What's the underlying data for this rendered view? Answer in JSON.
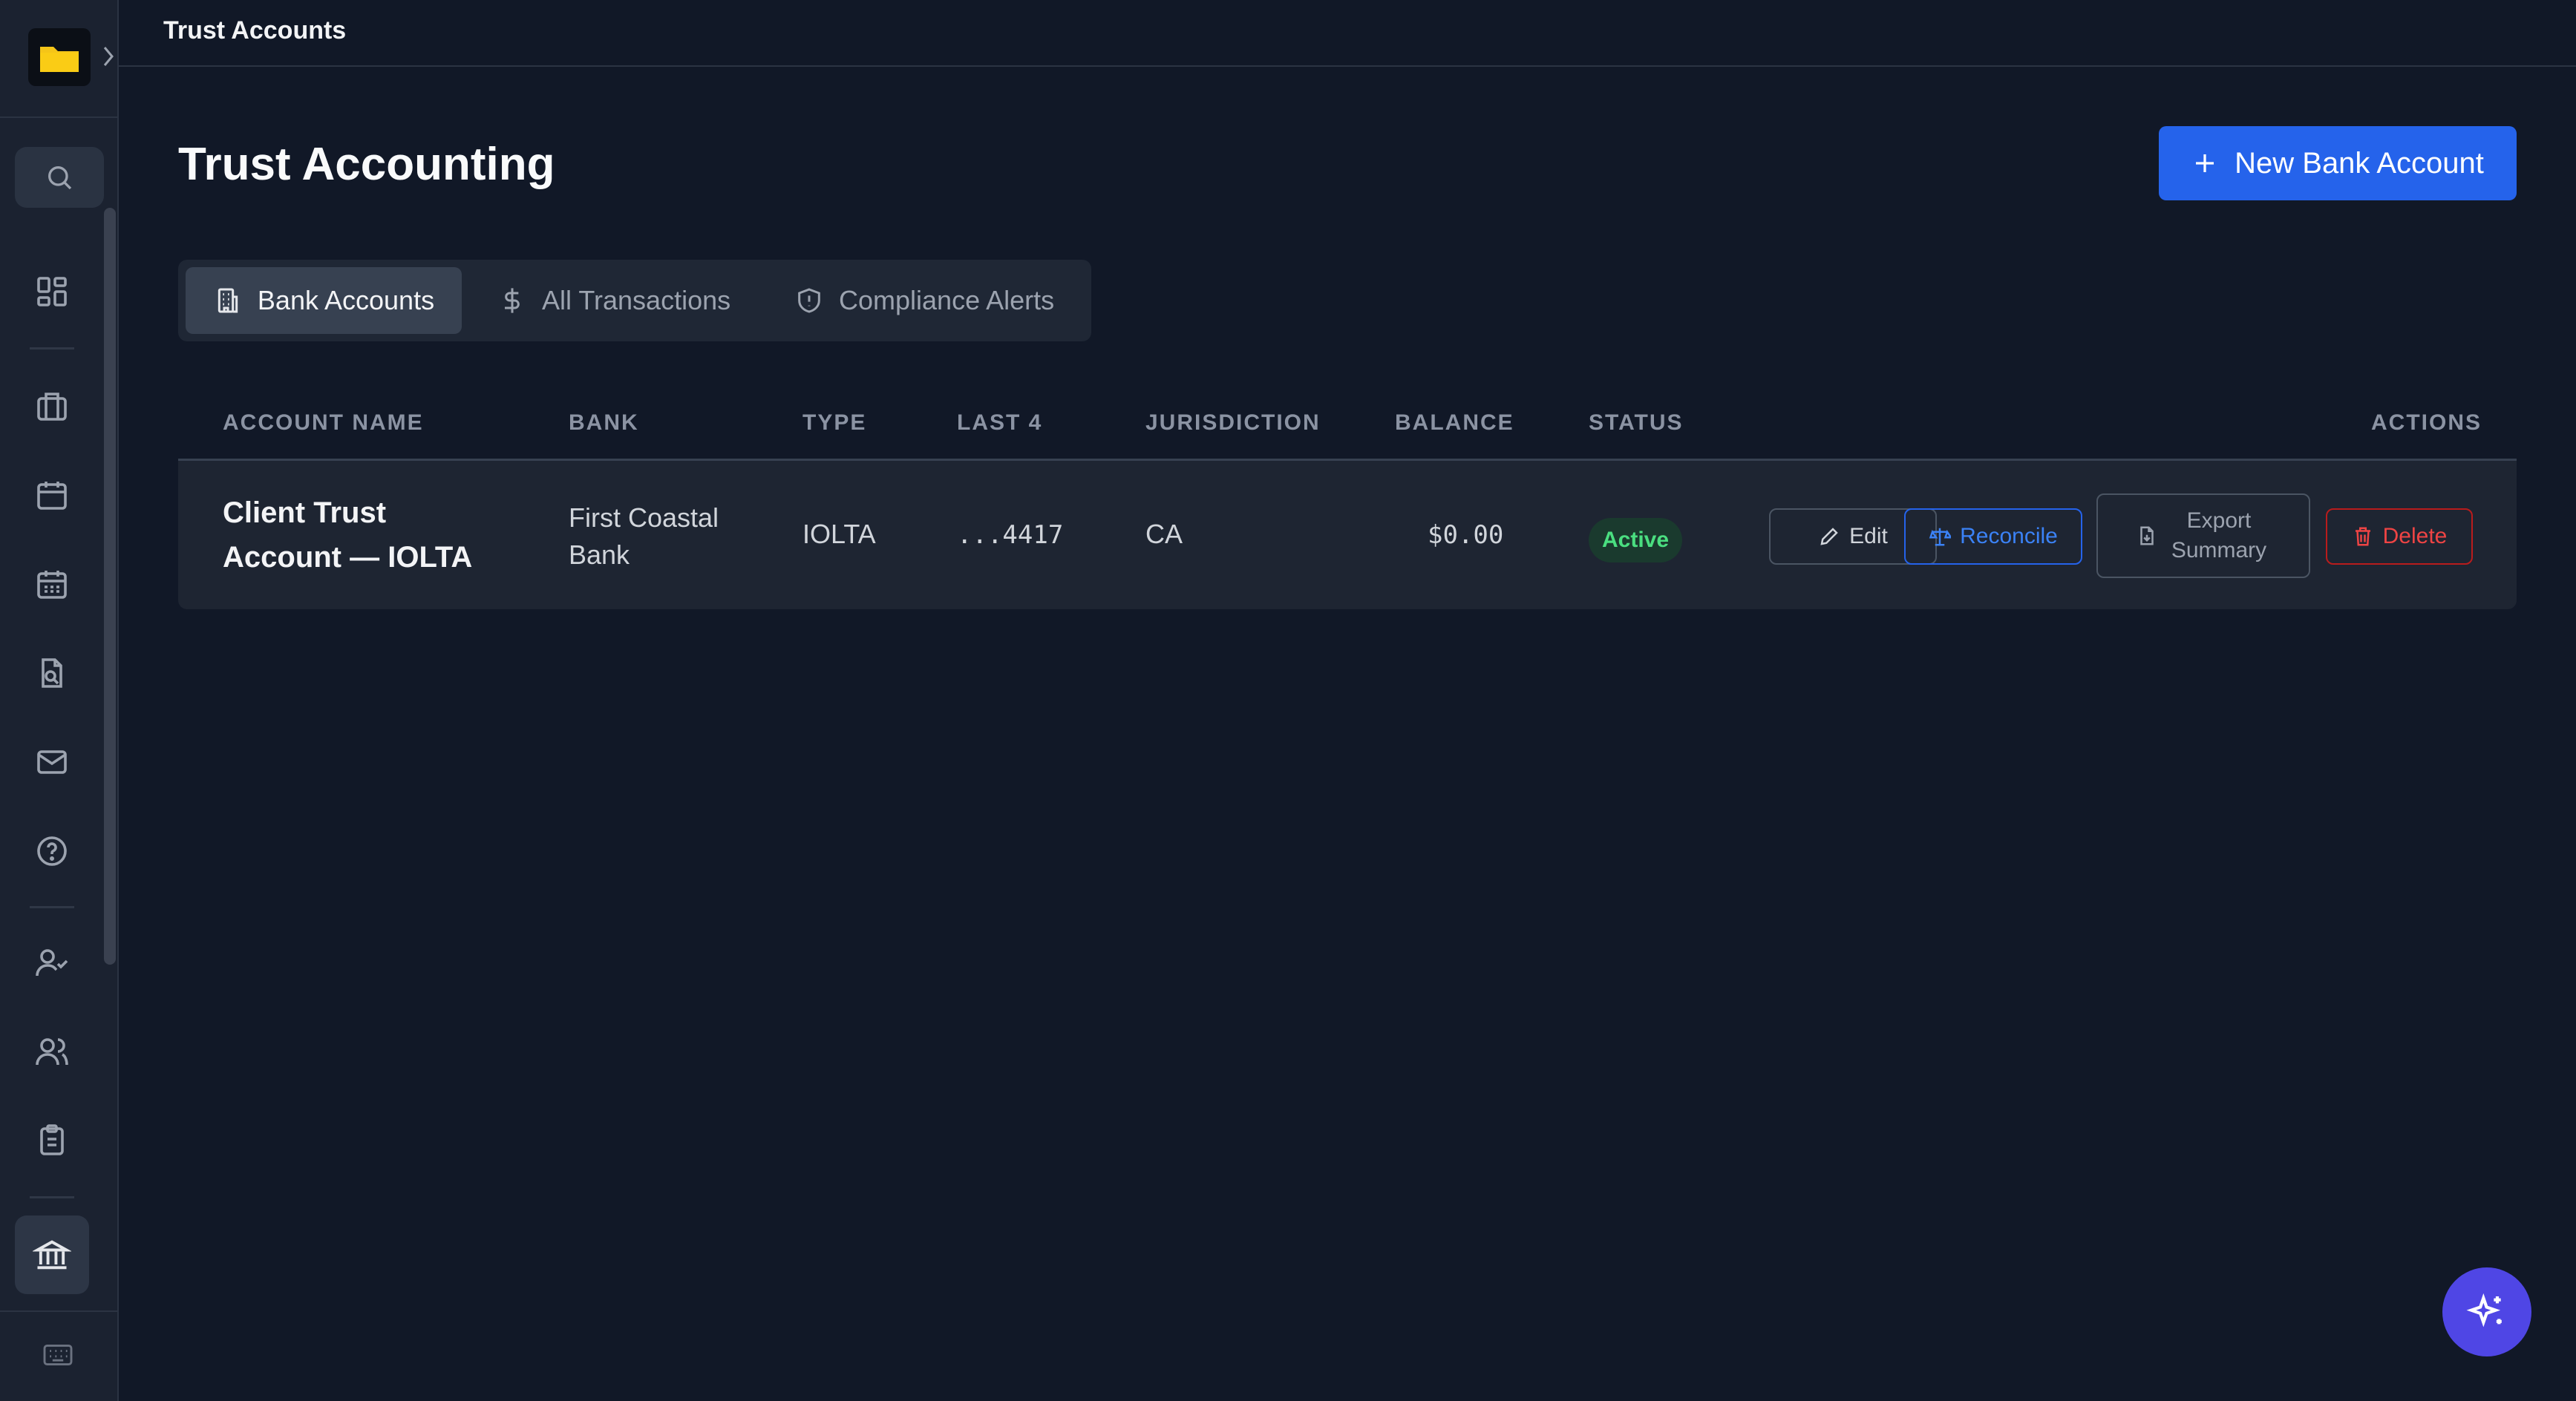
{
  "header": {
    "title": "Trust Accounts"
  },
  "page": {
    "title": "Trust Accounting",
    "new_button_label": "New Bank Account"
  },
  "tabs": [
    {
      "label": "Bank Accounts",
      "icon": "building-icon",
      "active": true
    },
    {
      "label": "All Transactions",
      "icon": "dollar-icon",
      "active": false
    },
    {
      "label": "Compliance Alerts",
      "icon": "shield-icon",
      "active": false
    }
  ],
  "table": {
    "columns": [
      "ACCOUNT NAME",
      "BANK",
      "TYPE",
      "LAST 4",
      "JURISDICTION",
      "BALANCE",
      "STATUS",
      "ACTIONS"
    ],
    "rows": [
      {
        "account_name": "Client Trust Account — IOLTA",
        "bank": "First Coastal Bank",
        "type": "IOLTA",
        "last4": "...4417",
        "jurisdiction": "CA",
        "balance": "$0.00",
        "status": "Active",
        "actions": {
          "edit": "Edit",
          "reconcile": "Reconcile",
          "export": "Export Summary",
          "delete": "Delete"
        }
      }
    ]
  },
  "sidebar": {
    "icons": [
      "dashboard-icon",
      "briefcase-icon",
      "calendar-icon",
      "calendar-grid-icon",
      "file-search-icon",
      "mail-icon",
      "help-icon",
      "user-check-icon",
      "users-icon",
      "clipboard-icon",
      "bank-icon",
      "keyboard-icon"
    ],
    "active": "bank-icon"
  },
  "colors": {
    "background": "#111827",
    "sidebar": "#1b2230",
    "primary": "#2563eb",
    "success": "#4ade80",
    "danger": "#ef4444",
    "fab": "#4f46e5"
  }
}
